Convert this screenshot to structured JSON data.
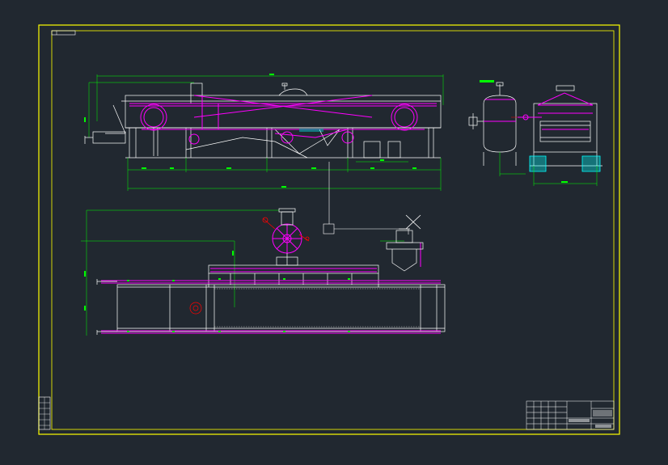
{
  "viewport": {
    "background": "#212830"
  },
  "colors": {
    "frame": "#ffff00",
    "structure": "#ffffff",
    "belt": "#ff00ff",
    "dimension": "#00ff00",
    "leader": "#ff0000",
    "hatch": "#00ffff"
  },
  "drawing": {
    "tag": "",
    "title_block": {
      "project": "",
      "drawing_no": "",
      "cells": []
    },
    "revision_strip": []
  },
  "icons": {
    "crosshair": "cursor-crosshair-icon"
  }
}
